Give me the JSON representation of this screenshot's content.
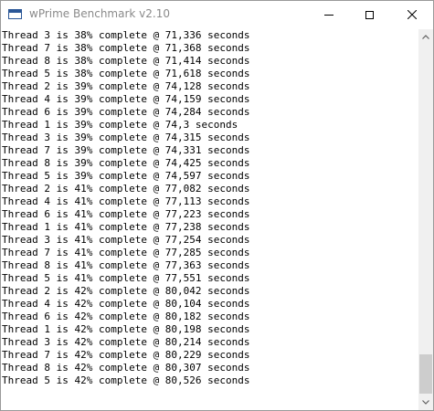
{
  "window": {
    "title": "wPrime Benchmark v2.10"
  },
  "icons": {
    "app": "app-window-icon",
    "minimize": "minimize-icon",
    "maximize": "maximize-icon",
    "close": "close-icon",
    "scroll_up": "chevron-up-icon",
    "scroll_down": "chevron-down-icon"
  },
  "scroll": {
    "position": 0.93
  },
  "log": [
    "Thread 3 is 38% complete @ 71,336 seconds",
    "Thread 7 is 38% complete @ 71,368 seconds",
    "Thread 8 is 38% complete @ 71,414 seconds",
    "Thread 5 is 38% complete @ 71,618 seconds",
    "Thread 2 is 39% complete @ 74,128 seconds",
    "Thread 4 is 39% complete @ 74,159 seconds",
    "Thread 6 is 39% complete @ 74,284 seconds",
    "Thread 1 is 39% complete @ 74,3 seconds",
    "Thread 3 is 39% complete @ 74,315 seconds",
    "Thread 7 is 39% complete @ 74,331 seconds",
    "Thread 8 is 39% complete @ 74,425 seconds",
    "Thread 5 is 39% complete @ 74,597 seconds",
    "Thread 2 is 41% complete @ 77,082 seconds",
    "Thread 4 is 41% complete @ 77,113 seconds",
    "Thread 6 is 41% complete @ 77,223 seconds",
    "Thread 1 is 41% complete @ 77,238 seconds",
    "Thread 3 is 41% complete @ 77,254 seconds",
    "Thread 7 is 41% complete @ 77,285 seconds",
    "Thread 8 is 41% complete @ 77,363 seconds",
    "Thread 5 is 41% complete @ 77,551 seconds",
    "Thread 2 is 42% complete @ 80,042 seconds",
    "Thread 4 is 42% complete @ 80,104 seconds",
    "Thread 6 is 42% complete @ 80,182 seconds",
    "Thread 1 is 42% complete @ 80,198 seconds",
    "Thread 3 is 42% complete @ 80,214 seconds",
    "Thread 7 is 42% complete @ 80,229 seconds",
    "Thread 8 is 42% complete @ 80,307 seconds",
    "Thread 5 is 42% complete @ 80,526 seconds"
  ]
}
